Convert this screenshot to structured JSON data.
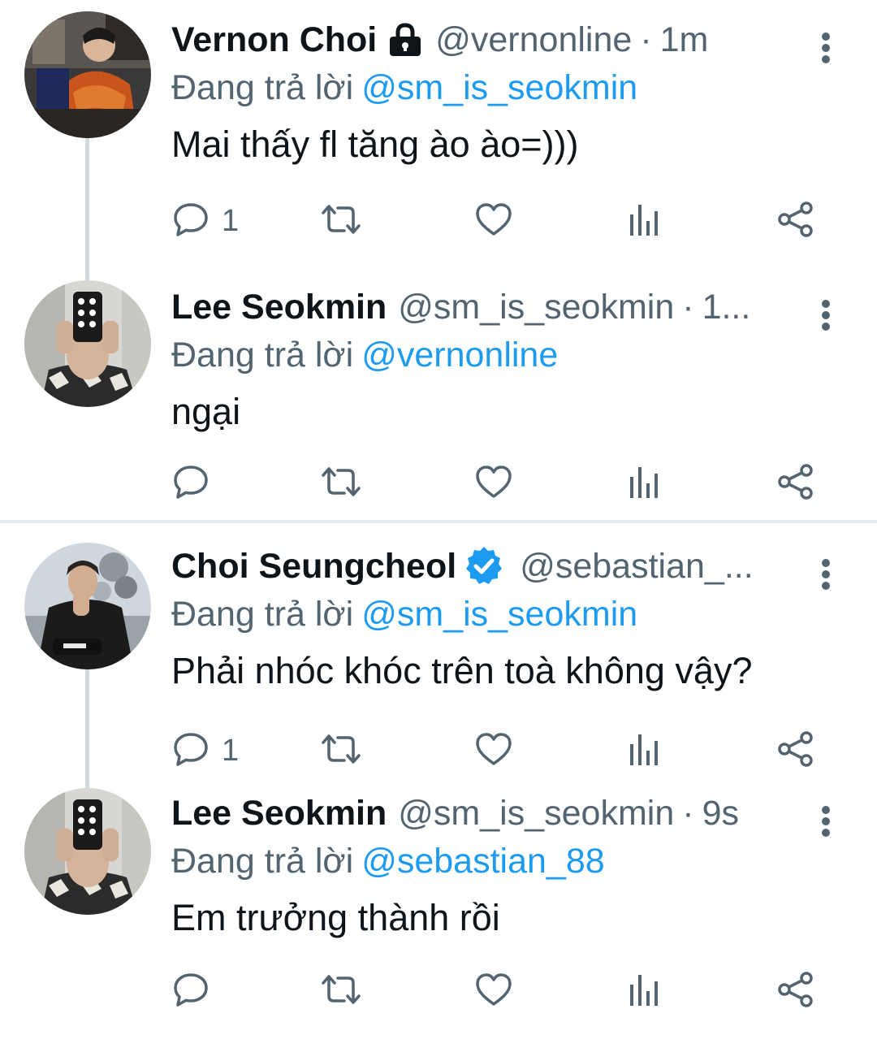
{
  "colors": {
    "accent": "#1d9bf0",
    "secondary_text": "#536471",
    "primary_text": "#0f1419",
    "thread_line": "#cfd9de",
    "divider": "#e6ecf0"
  },
  "threads": [
    {
      "tweets": [
        {
          "name": "Vernon Choi",
          "badge": "lock-icon",
          "handle": "@vernonline",
          "separator": "·",
          "time": "1m",
          "reply_prefix": "Đang trả lời",
          "reply_to": "@sm_is_seokmin",
          "text": "Mai thấy fl tăng ào ào=)))",
          "reply_count": "1"
        },
        {
          "name": "Lee Seokmin",
          "badge": "",
          "handle": "@sm_is_seokmin",
          "separator": "·",
          "time": "1...",
          "reply_prefix": "Đang trả lời",
          "reply_to": "@vernonline",
          "text": "ngại",
          "reply_count": ""
        }
      ]
    },
    {
      "tweets": [
        {
          "name": "Choi Seungcheol",
          "badge": "verified-icon",
          "handle": "@sebastian_...",
          "separator": "",
          "time": "",
          "reply_prefix": "Đang trả lời",
          "reply_to": "@sm_is_seokmin",
          "text": "Phải nhóc khóc trên toà không vậy?",
          "reply_count": "1"
        },
        {
          "name": "Lee Seokmin",
          "badge": "",
          "handle": "@sm_is_seokmin",
          "separator": "·",
          "time": "9s",
          "reply_prefix": "Đang trả lời",
          "reply_to": "@sebastian_88",
          "text": "Em trưởng thành rồi",
          "reply_count": ""
        }
      ]
    }
  ]
}
